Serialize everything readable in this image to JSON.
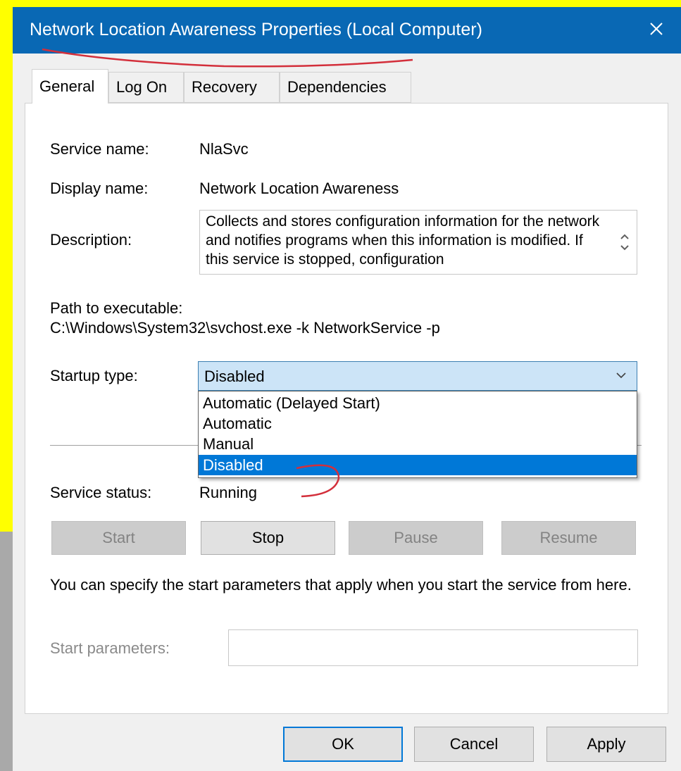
{
  "window": {
    "title": "Network Location Awareness Properties (Local Computer)",
    "close_symbol": "✕"
  },
  "tabs": [
    {
      "label": "General",
      "active": true
    },
    {
      "label": "Log On",
      "active": false
    },
    {
      "label": "Recovery",
      "active": false
    },
    {
      "label": "Dependencies",
      "active": false
    }
  ],
  "general": {
    "service_name_label": "Service name:",
    "service_name_value": "NlaSvc",
    "display_name_label": "Display name:",
    "display_name_value": "Network Location Awareness",
    "description_label": "Description:",
    "description_value": "Collects and stores configuration information for the network and notifies programs when this information is modified. If this service is stopped, configuration",
    "path_label": "Path to executable:",
    "path_value": "C:\\Windows\\System32\\svchost.exe -k NetworkService -p",
    "startup_type_label": "Startup type:",
    "startup_type_value": "Disabled",
    "startup_options": [
      "Automatic (Delayed Start)",
      "Automatic",
      "Manual",
      "Disabled"
    ],
    "startup_selected_index": 3,
    "service_status_label": "Service status:",
    "service_status_value": "Running",
    "buttons": {
      "start": "Start",
      "stop": "Stop",
      "pause": "Pause",
      "resume": "Resume"
    },
    "start_params_hint": "You can specify the start parameters that apply when you start the service from here.",
    "start_params_label": "Start parameters:",
    "start_params_value": ""
  },
  "footer": {
    "ok": "OK",
    "cancel": "Cancel",
    "apply": "Apply"
  },
  "colors": {
    "titlebar": "#0968b4",
    "highlight": "#0078d7",
    "annotation": "#d32f3b",
    "background_accent": "#ffff00"
  }
}
